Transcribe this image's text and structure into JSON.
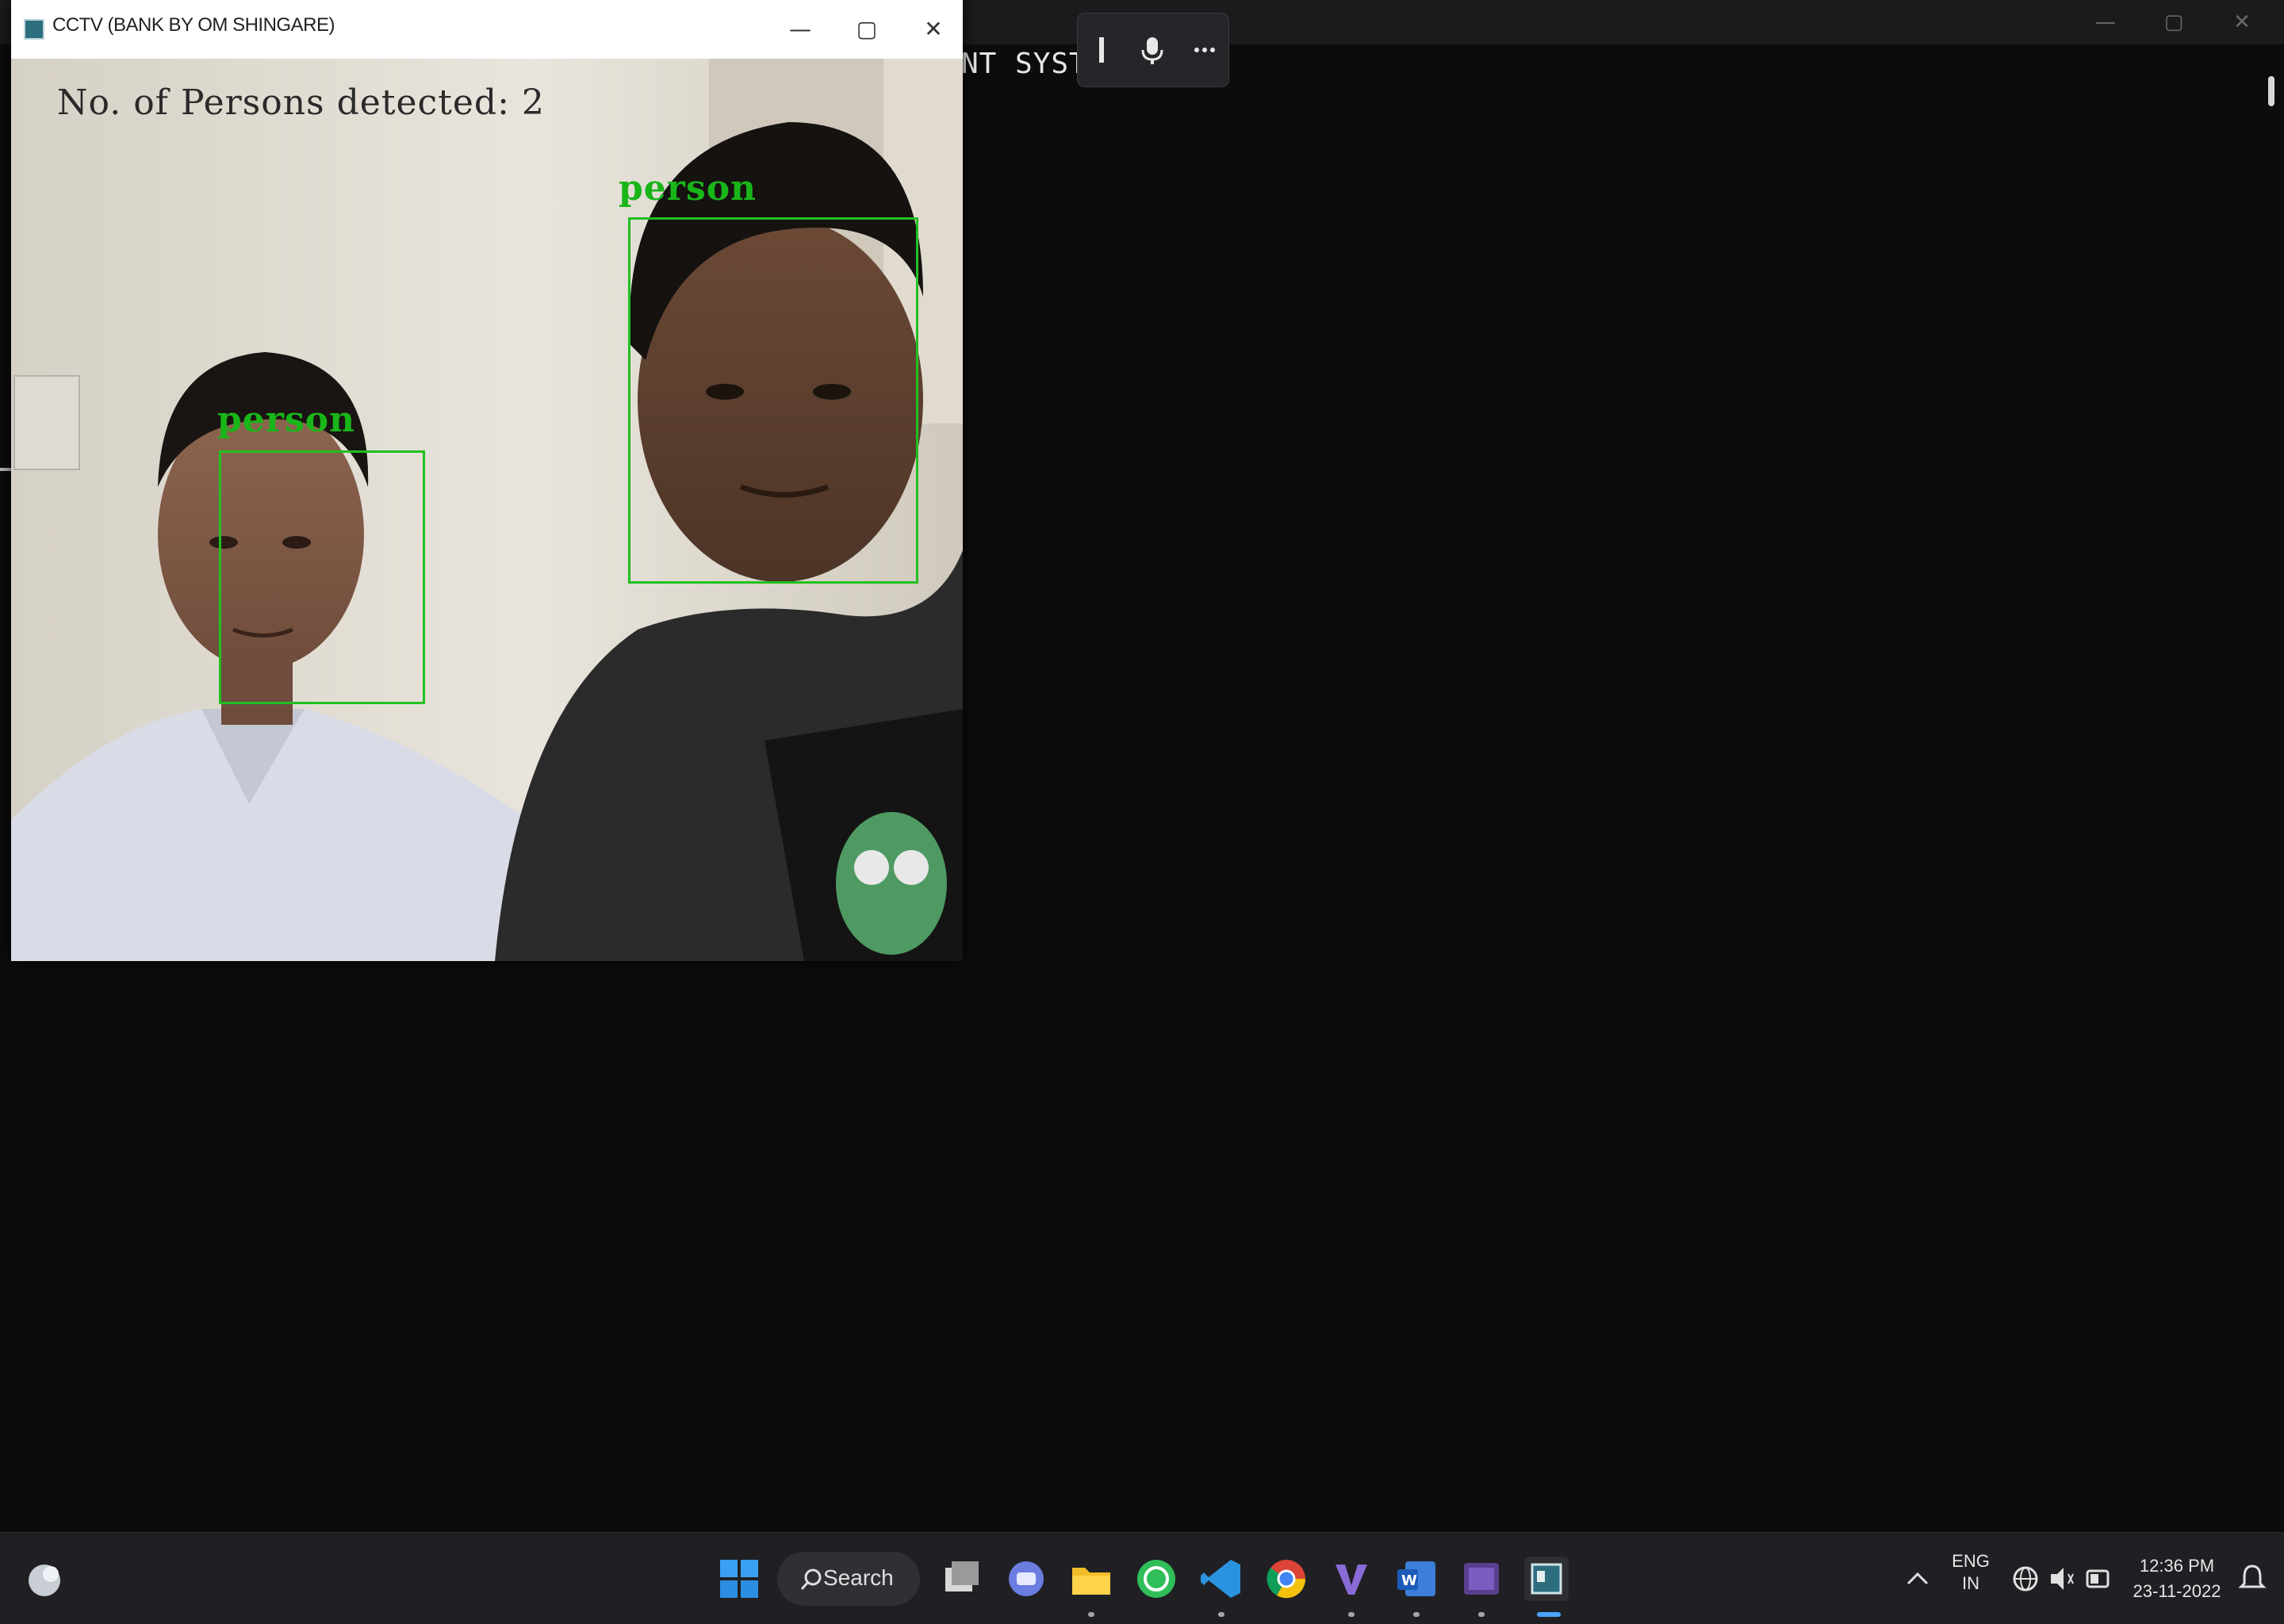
{
  "terminal": {
    "visible_text": "NT SYST",
    "controls": [
      "—",
      "▢",
      "✕"
    ]
  },
  "voice_toolbar": {
    "icons": [
      "cursor-bar-icon",
      "microphone-icon",
      "more-icon"
    ]
  },
  "cctv_window": {
    "title": "CCTV (BANK BY OM SHINGARE)",
    "controls": {
      "minimize": "—",
      "maximize": "▢",
      "close": "✕"
    },
    "overlay_text": "No. of Persons detected: 2",
    "detection_label": "person",
    "detections": [
      {
        "label": "person"
      },
      {
        "label": "person"
      }
    ],
    "box_color": "#21c021"
  },
  "taskbar": {
    "search_label": "Search",
    "apps": [
      "start-icon",
      "search",
      "task-view-icon",
      "chat-icon",
      "file-explorer-icon",
      "whatsapp-icon",
      "vscode-icon",
      "chrome-icon",
      "visual-studio-icon",
      "word-icon",
      "media-icon",
      "cctv-app-icon"
    ],
    "tray": {
      "language": "ENG",
      "region": "IN",
      "time": "12:36 PM",
      "date": "23-11-2022"
    }
  }
}
